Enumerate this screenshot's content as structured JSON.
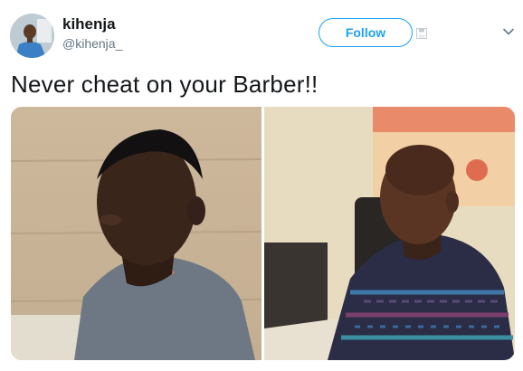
{
  "tweet": {
    "display_name": "kihenja",
    "handle": "@kihenja_",
    "follow_label": "Follow",
    "text": "Never cheat on your Barber!!"
  },
  "icons": {
    "avatar": "profile-photo",
    "save": "save-icon",
    "more": "chevron-down-icon"
  },
  "photos": [
    {
      "name": "man-with-full-haircut-photo"
    },
    {
      "name": "man-with-shaved-head-photo"
    }
  ],
  "colors": {
    "accent": "#1da1f2",
    "name_text": "#14171a",
    "secondary_text": "#657786"
  }
}
